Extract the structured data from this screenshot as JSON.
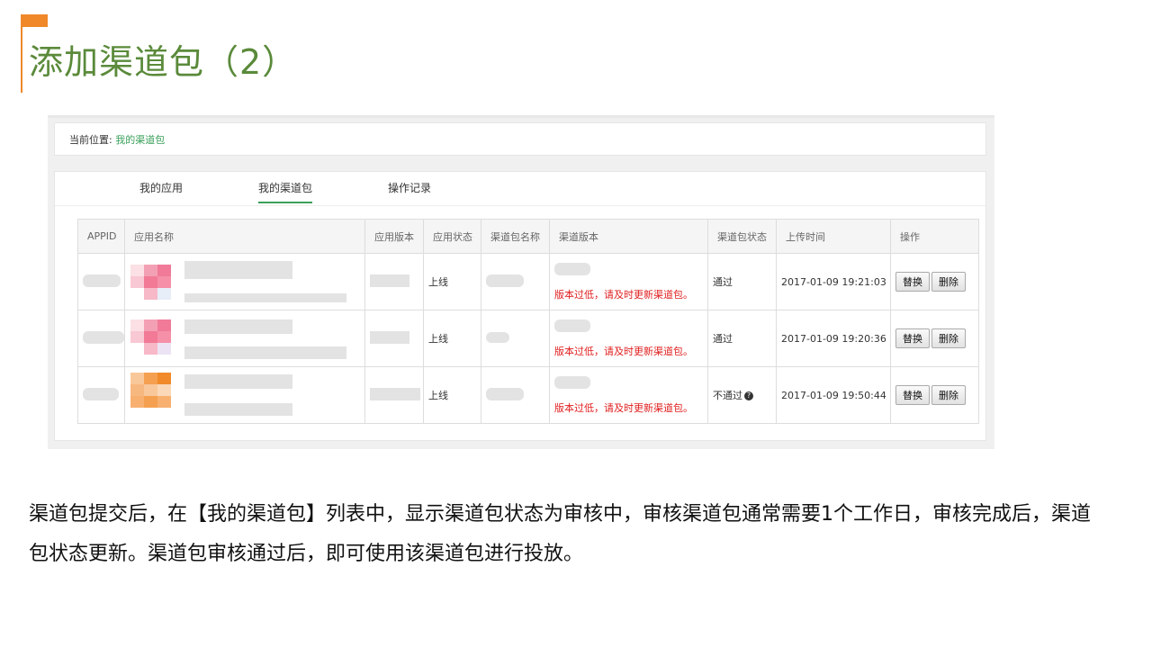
{
  "slide": {
    "title": "添加渠道包（2）",
    "description": "渠道包提交后，在【我的渠道包】列表中，显示渠道包状态为审核中，审核渠道包通常需要1个工作日，审核完成后，渠道包状态更新。渠道包审核通过后，即可使用该渠道包进行投放。"
  },
  "colors": {
    "accent": "#f0882a",
    "title": "#5a8a3a",
    "link": "#3aa05a",
    "warning": "#e02020"
  },
  "breadcrumb": {
    "label": "当前位置:",
    "current": "我的渠道包"
  },
  "tabs": [
    {
      "label": "我的应用"
    },
    {
      "label": "我的渠道包"
    },
    {
      "label": "操作记录"
    }
  ],
  "table": {
    "headers": [
      "APPID",
      "应用名称",
      "应用版本",
      "应用状态",
      "渠道包名称",
      "渠道版本",
      "渠道包状态",
      "上传时间",
      "操作"
    ],
    "rows": [
      {
        "status": "上线",
        "warning": "版本过低，请及时更新渠道包。",
        "pkg_status": "通过",
        "time": "2017-01-09 19:21:03",
        "replace": "替换",
        "delete": "删除"
      },
      {
        "status": "上线",
        "warning": "版本过低，请及时更新渠道包。",
        "pkg_status": "通过",
        "time": "2017-01-09 19:20:36",
        "replace": "替换",
        "delete": "删除"
      },
      {
        "status": "上线",
        "warning": "版本过低，请及时更新渠道包。",
        "pkg_status": "不通过",
        "time": "2017-01-09 19:50:44",
        "replace": "替换",
        "delete": "删除"
      }
    ],
    "help_icon": "question-circle-icon"
  }
}
